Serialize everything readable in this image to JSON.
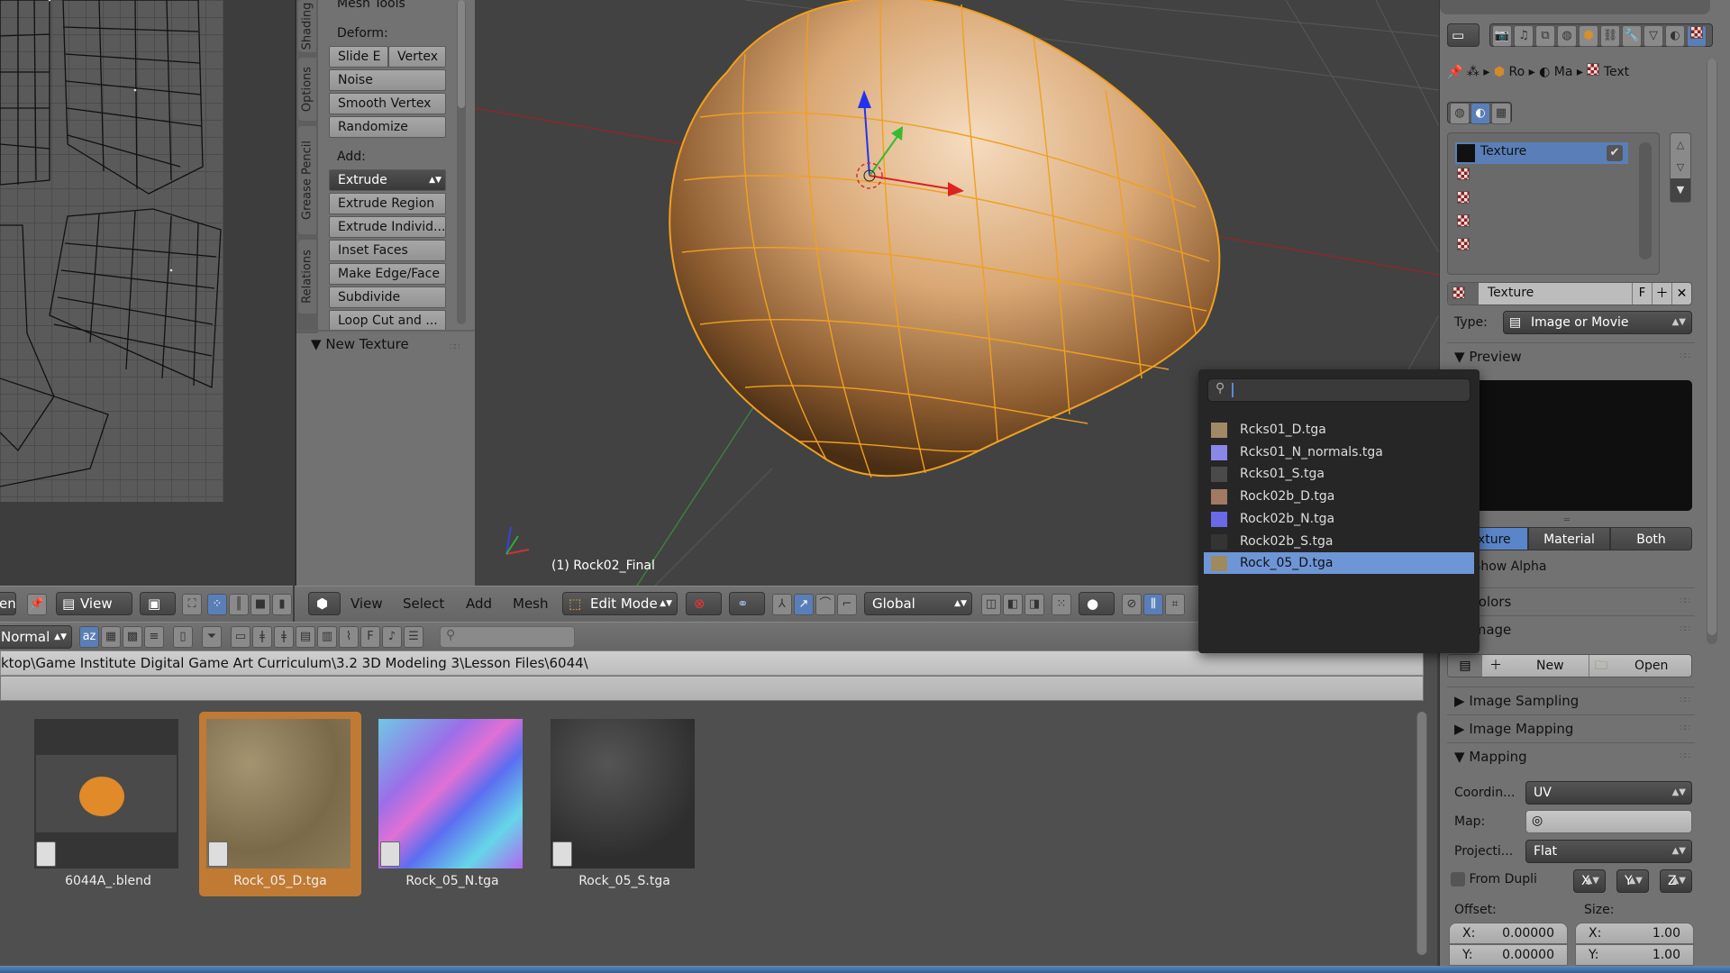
{
  "tool_shelf": {
    "vertical_tabs": [
      "Shading",
      "Options",
      "Grease Pencil",
      "Relations"
    ],
    "panel_title": "Mesh Tools",
    "deform_label": "Deform:",
    "deform_buttons": [
      "Slide E",
      "Vertex",
      "Noise",
      "Smooth Vertex",
      "Randomize"
    ],
    "add_label": "Add:",
    "add_buttons": [
      "Extrude",
      "Extrude Region",
      "Extrude Individ...",
      "Inset Faces",
      "Make Edge/Face",
      "Subdivide",
      "Loop Cut and ..."
    ],
    "new_texture_panel": "New Texture"
  },
  "viewport": {
    "object_label": "(1) Rock02_Final",
    "header": {
      "menus": [
        "View",
        "Select",
        "Add",
        "Mesh"
      ],
      "mode": "Edit Mode",
      "orientation": "Global"
    }
  },
  "uv_header": {
    "menu_partial": "en",
    "view_label": "View"
  },
  "file_browser": {
    "display_mode": "Normal",
    "path": "ktop\\Game Institute Digital Game Art  Curriculum\\3.2 3D Modeling 3\\Lesson Files\\6044\\",
    "files": [
      {
        "name": "6044A_.blend",
        "type": "blend",
        "selected": false
      },
      {
        "name": "Rock_05_D.tga",
        "type": "image",
        "selected": true
      },
      {
        "name": "Rock_05_N.tga",
        "type": "image",
        "selected": false
      },
      {
        "name": "Rock_05_S.tga",
        "type": "image",
        "selected": false
      }
    ]
  },
  "image_popup": {
    "search_value": "",
    "items": [
      {
        "name": "Rcks01_D.tga",
        "swatch": "#a08a66"
      },
      {
        "name": "Rcks01_N_normals.tga",
        "swatch": "#8a88e6"
      },
      {
        "name": "Rcks01_S.tga",
        "swatch": "#4a4a4a"
      },
      {
        "name": "Rock02b_D.tga",
        "swatch": "#a07a62"
      },
      {
        "name": "Rock02b_N.tga",
        "swatch": "#6a6ae8"
      },
      {
        "name": "Rock02b_S.tga",
        "swatch": "#343434"
      },
      {
        "name": "Rock_05_D.tga",
        "swatch": "#9e8a5e",
        "active": true
      }
    ]
  },
  "properties": {
    "breadcrumb": [
      "Ro",
      "Ma",
      "Text"
    ],
    "texture_slots": [
      {
        "name": "Texture",
        "enabled": true,
        "active": true
      },
      {
        "name": "",
        "enabled": false
      },
      {
        "name": "",
        "enabled": false
      },
      {
        "name": "",
        "enabled": false
      },
      {
        "name": "",
        "enabled": false
      }
    ],
    "texture_name": "Texture",
    "texture_fake_user": "F",
    "type_label": "Type:",
    "type_value": "Image or Movie",
    "preview_section": "Preview",
    "preview_tabs": [
      "Texture",
      "Material",
      "Both"
    ],
    "preview_active_tab": "Texture",
    "show_alpha_label": "Show Alpha",
    "sections": [
      "Colors",
      "Image"
    ],
    "image_new_label": "New",
    "image_open_label": "Open",
    "collapsed_sections": [
      "Image Sampling",
      "Image Mapping"
    ],
    "mapping_section": "Mapping",
    "coordinates_label": "Coordin...",
    "coordinates_value": "UV",
    "map_label": "Map:",
    "projection_label": "Projecti...",
    "projection_value": "Flat",
    "from_dupli_label": "From Dupli",
    "axis_buttons": [
      "X",
      "Y",
      "Z"
    ],
    "offset_label": "Offset:",
    "size_label": "Size:",
    "offset": {
      "x": "0.00000",
      "y": "0.00000"
    },
    "size": {
      "x": "1.00",
      "y": "1.00"
    }
  }
}
